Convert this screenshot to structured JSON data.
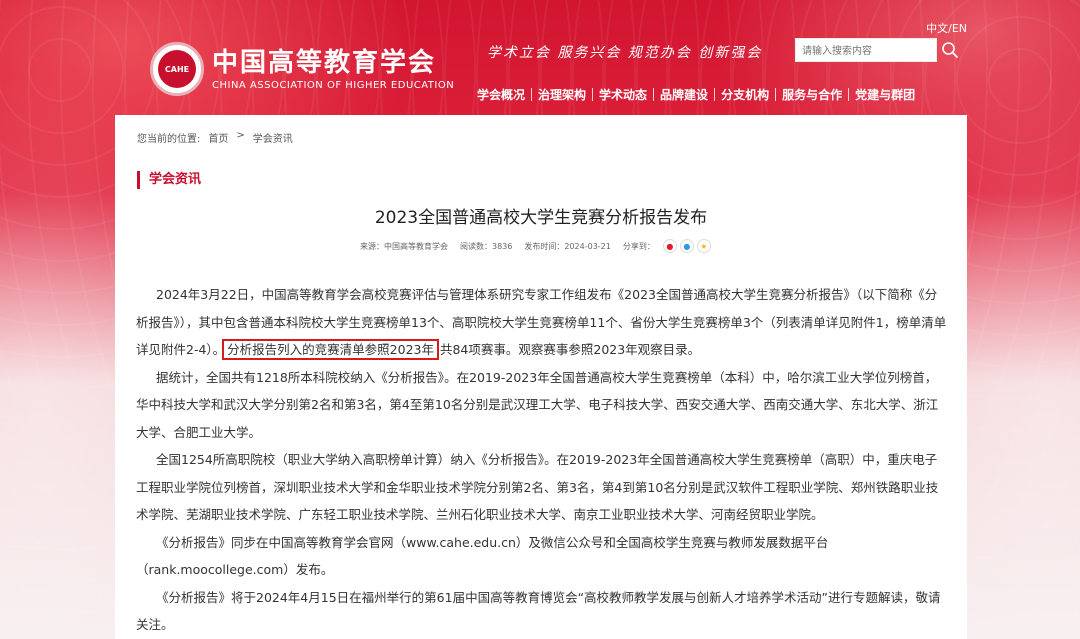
{
  "header": {
    "lang": [
      "中文",
      "/",
      "EN"
    ],
    "logo": {
      "emblem_text": "CAHE",
      "cn": "中国高等教育学会",
      "en": "CHINA ASSOCIATION OF HIGHER EDUCATION"
    },
    "slogan": "学术立会  服务兴会  规范办会  创新强会",
    "search_placeholder": "请输入搜索内容",
    "nav": [
      "学会概况",
      "治理架构",
      "学术动态",
      "品牌建设",
      "分支机构",
      "服务与合作",
      "党建与群团"
    ]
  },
  "breadcrumb": {
    "prefix": "您当前的位置:",
    "home": "首页",
    "sep": ">",
    "current": "学会资讯"
  },
  "section_title": "学会资讯",
  "article": {
    "title": "2023全国普通高校大学生竞赛分析报告发布",
    "meta": {
      "source": "来源：中国高等教育学会",
      "views": "阅读数：3836",
      "date": "发布时间：2024-03-21",
      "share_label": "分享到："
    },
    "p1a": "2024年3月22日，中国高等教育学会高校竞赛评估与管理体系研究专家工作组发布《2023全国普通高校大学生竞赛分析报告》（以下简称《分析报告》），其中包含普通本科院校大学生竞赛榜单13个、高职院校大学生竞赛榜单11个、省份大学生竞赛榜单3个（列表清单详见附件1，榜单清单详见附件2-4）。",
    "p1_highlight": "分析报告列入的竞赛清单参照2023年",
    "p1b": " 共84项赛事。观察赛事参照2023年观察目录。",
    "p2": "据统计，全国共有1218所本科院校纳入《分析报告》。在2019-2023年全国普通高校大学生竞赛榜单（本科）中，哈尔滨工业大学位列榜首，华中科技大学和武汉大学分别第2名和第3名，第4至第10名分别是武汉理工大学、电子科技大学、西安交通大学、西南交通大学、东北大学、浙江大学、合肥工业大学。",
    "p3": "全国1254所高职院校（职业大学纳入高职榜单计算）纳入《分析报告》。在2019-2023年全国普通高校大学生竞赛榜单（高职）中，重庆电子工程职业学院位列榜首，深圳职业技术大学和金华职业技术学院分别第2名、第3名，第4到第10名分别是武汉软件工程职业学院、郑州铁路职业技术学院、芜湖职业技术学院、广东轻工职业技术学院、兰州石化职业技术大学、南京工业职业技术大学、河南经贸职业学院。",
    "p4": "《分析报告》同步在中国高等教育学会官网（www.cahe.edu.cn）及微信公众号和全国高校学生竞赛与教师发展数据平台（rank.moocollege.com）发布。",
    "p5": "《分析报告》将于2024年4月15日在福州举行的第61届中国高等教育博览会“高校教师教学发展与创新人才培养学术活动”进行专题解读，敬请关注。"
  },
  "colors": {
    "brand_red": "#c8102e",
    "highlight_box": "#d71a1a"
  }
}
